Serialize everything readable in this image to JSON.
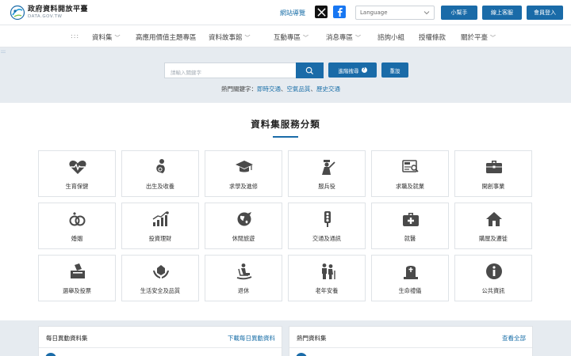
{
  "header": {
    "logo_title": "政府資料開放平臺",
    "logo_sub": "DATA.GOV.TW",
    "site_guide": "網站導覽",
    "language_placeholder": "Language",
    "btn_helper": "小幫手",
    "btn_service": "線上客服",
    "btn_login": "會員登入"
  },
  "nav": {
    "dots": ":::",
    "items": [
      {
        "label": "資料集",
        "dd": true
      },
      {
        "label": "高應用價值主題專區",
        "dd": false
      },
      {
        "label": "資料故事館",
        "dd": true
      },
      {
        "label": "互動專區",
        "dd": true
      },
      {
        "label": "消息專區",
        "dd": true
      },
      {
        "label": "諮詢小組",
        "dd": false
      },
      {
        "label": "授權條款",
        "dd": false
      },
      {
        "label": "關於平臺",
        "dd": true
      }
    ]
  },
  "search": {
    "corner_dots": ":::",
    "placeholder": "請輸入關鍵字",
    "advanced_label": "進階搜尋",
    "advanced_q": "?",
    "reset_label": "重設",
    "hot_prefix": "熱門關鍵字：",
    "hot_keywords": [
      "即時交通",
      "空氣品質",
      "歷史交通"
    ],
    "hot_sep": "、"
  },
  "categories_title": "資料集服務分類",
  "categories": [
    {
      "label": "生育保健",
      "icon": "heart-pulse-icon"
    },
    {
      "label": "出生及收養",
      "icon": "baby-icon"
    },
    {
      "label": "求學及進修",
      "icon": "graduation-cap-icon"
    },
    {
      "label": "服兵役",
      "icon": "soldier-icon"
    },
    {
      "label": "求職及就業",
      "icon": "job-search-icon"
    },
    {
      "label": "開創事業",
      "icon": "briefcase-icon"
    },
    {
      "label": "婚姻",
      "icon": "rings-icon"
    },
    {
      "label": "投資理財",
      "icon": "investment-chart-icon"
    },
    {
      "label": "休閒旅遊",
      "icon": "globe-travel-icon"
    },
    {
      "label": "交通及通訊",
      "icon": "traffic-light-icon"
    },
    {
      "label": "就醫",
      "icon": "medical-kit-icon"
    },
    {
      "label": "購屋及遷徙",
      "icon": "house-icon"
    },
    {
      "label": "選舉及投票",
      "icon": "ballot-box-icon"
    },
    {
      "label": "生活安全及品質",
      "icon": "safety-hands-icon"
    },
    {
      "label": "退休",
      "icon": "retirement-rocking-chair-icon"
    },
    {
      "label": "老年安養",
      "icon": "elderly-couple-icon"
    },
    {
      "label": "生命禮儀",
      "icon": "tombstone-icon"
    },
    {
      "label": "公共資訊",
      "icon": "info-icon"
    }
  ],
  "panels": {
    "daily_title": "每日異動資料集",
    "daily_link": "下載每日異動資料",
    "hot_title": "熱門資料集",
    "hot_link": "查看全部"
  },
  "colors": {
    "primary": "#1a6ba8",
    "link": "#1a6fa8",
    "icon": "#4a4a4a"
  }
}
